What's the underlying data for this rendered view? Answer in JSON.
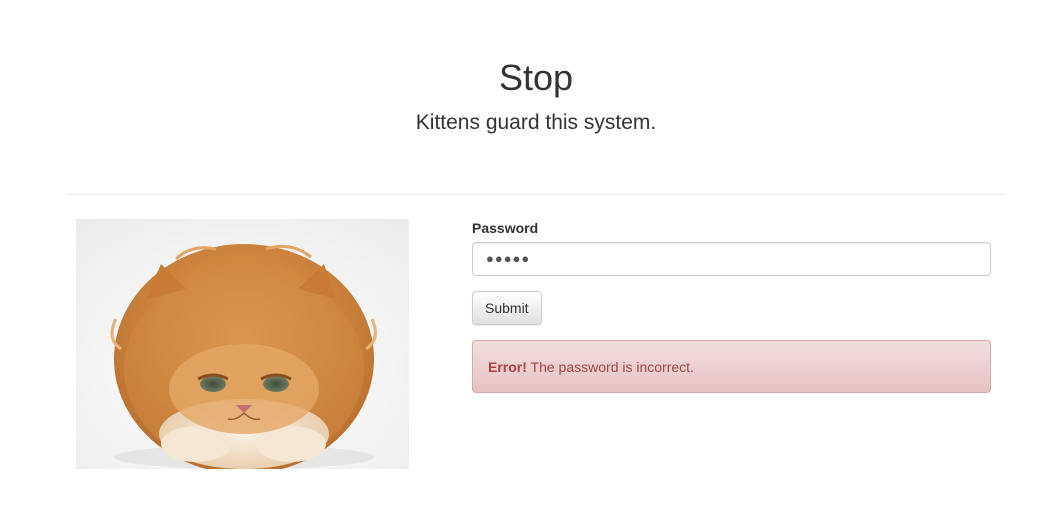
{
  "header": {
    "title": "Stop",
    "subtitle": "Kittens guard this system."
  },
  "image": {
    "description_icon": "kitten-photo"
  },
  "form": {
    "password_label": "Password",
    "password_value_masked": "●●●●●",
    "submit_label": "Submit"
  },
  "alert": {
    "strong": "Error!",
    "message": "The password is incorrect."
  },
  "colors": {
    "alert_text": "#a94442",
    "alert_bg": "#f2dede",
    "alert_border": "#dca7a7",
    "divider": "#eeeeee"
  }
}
